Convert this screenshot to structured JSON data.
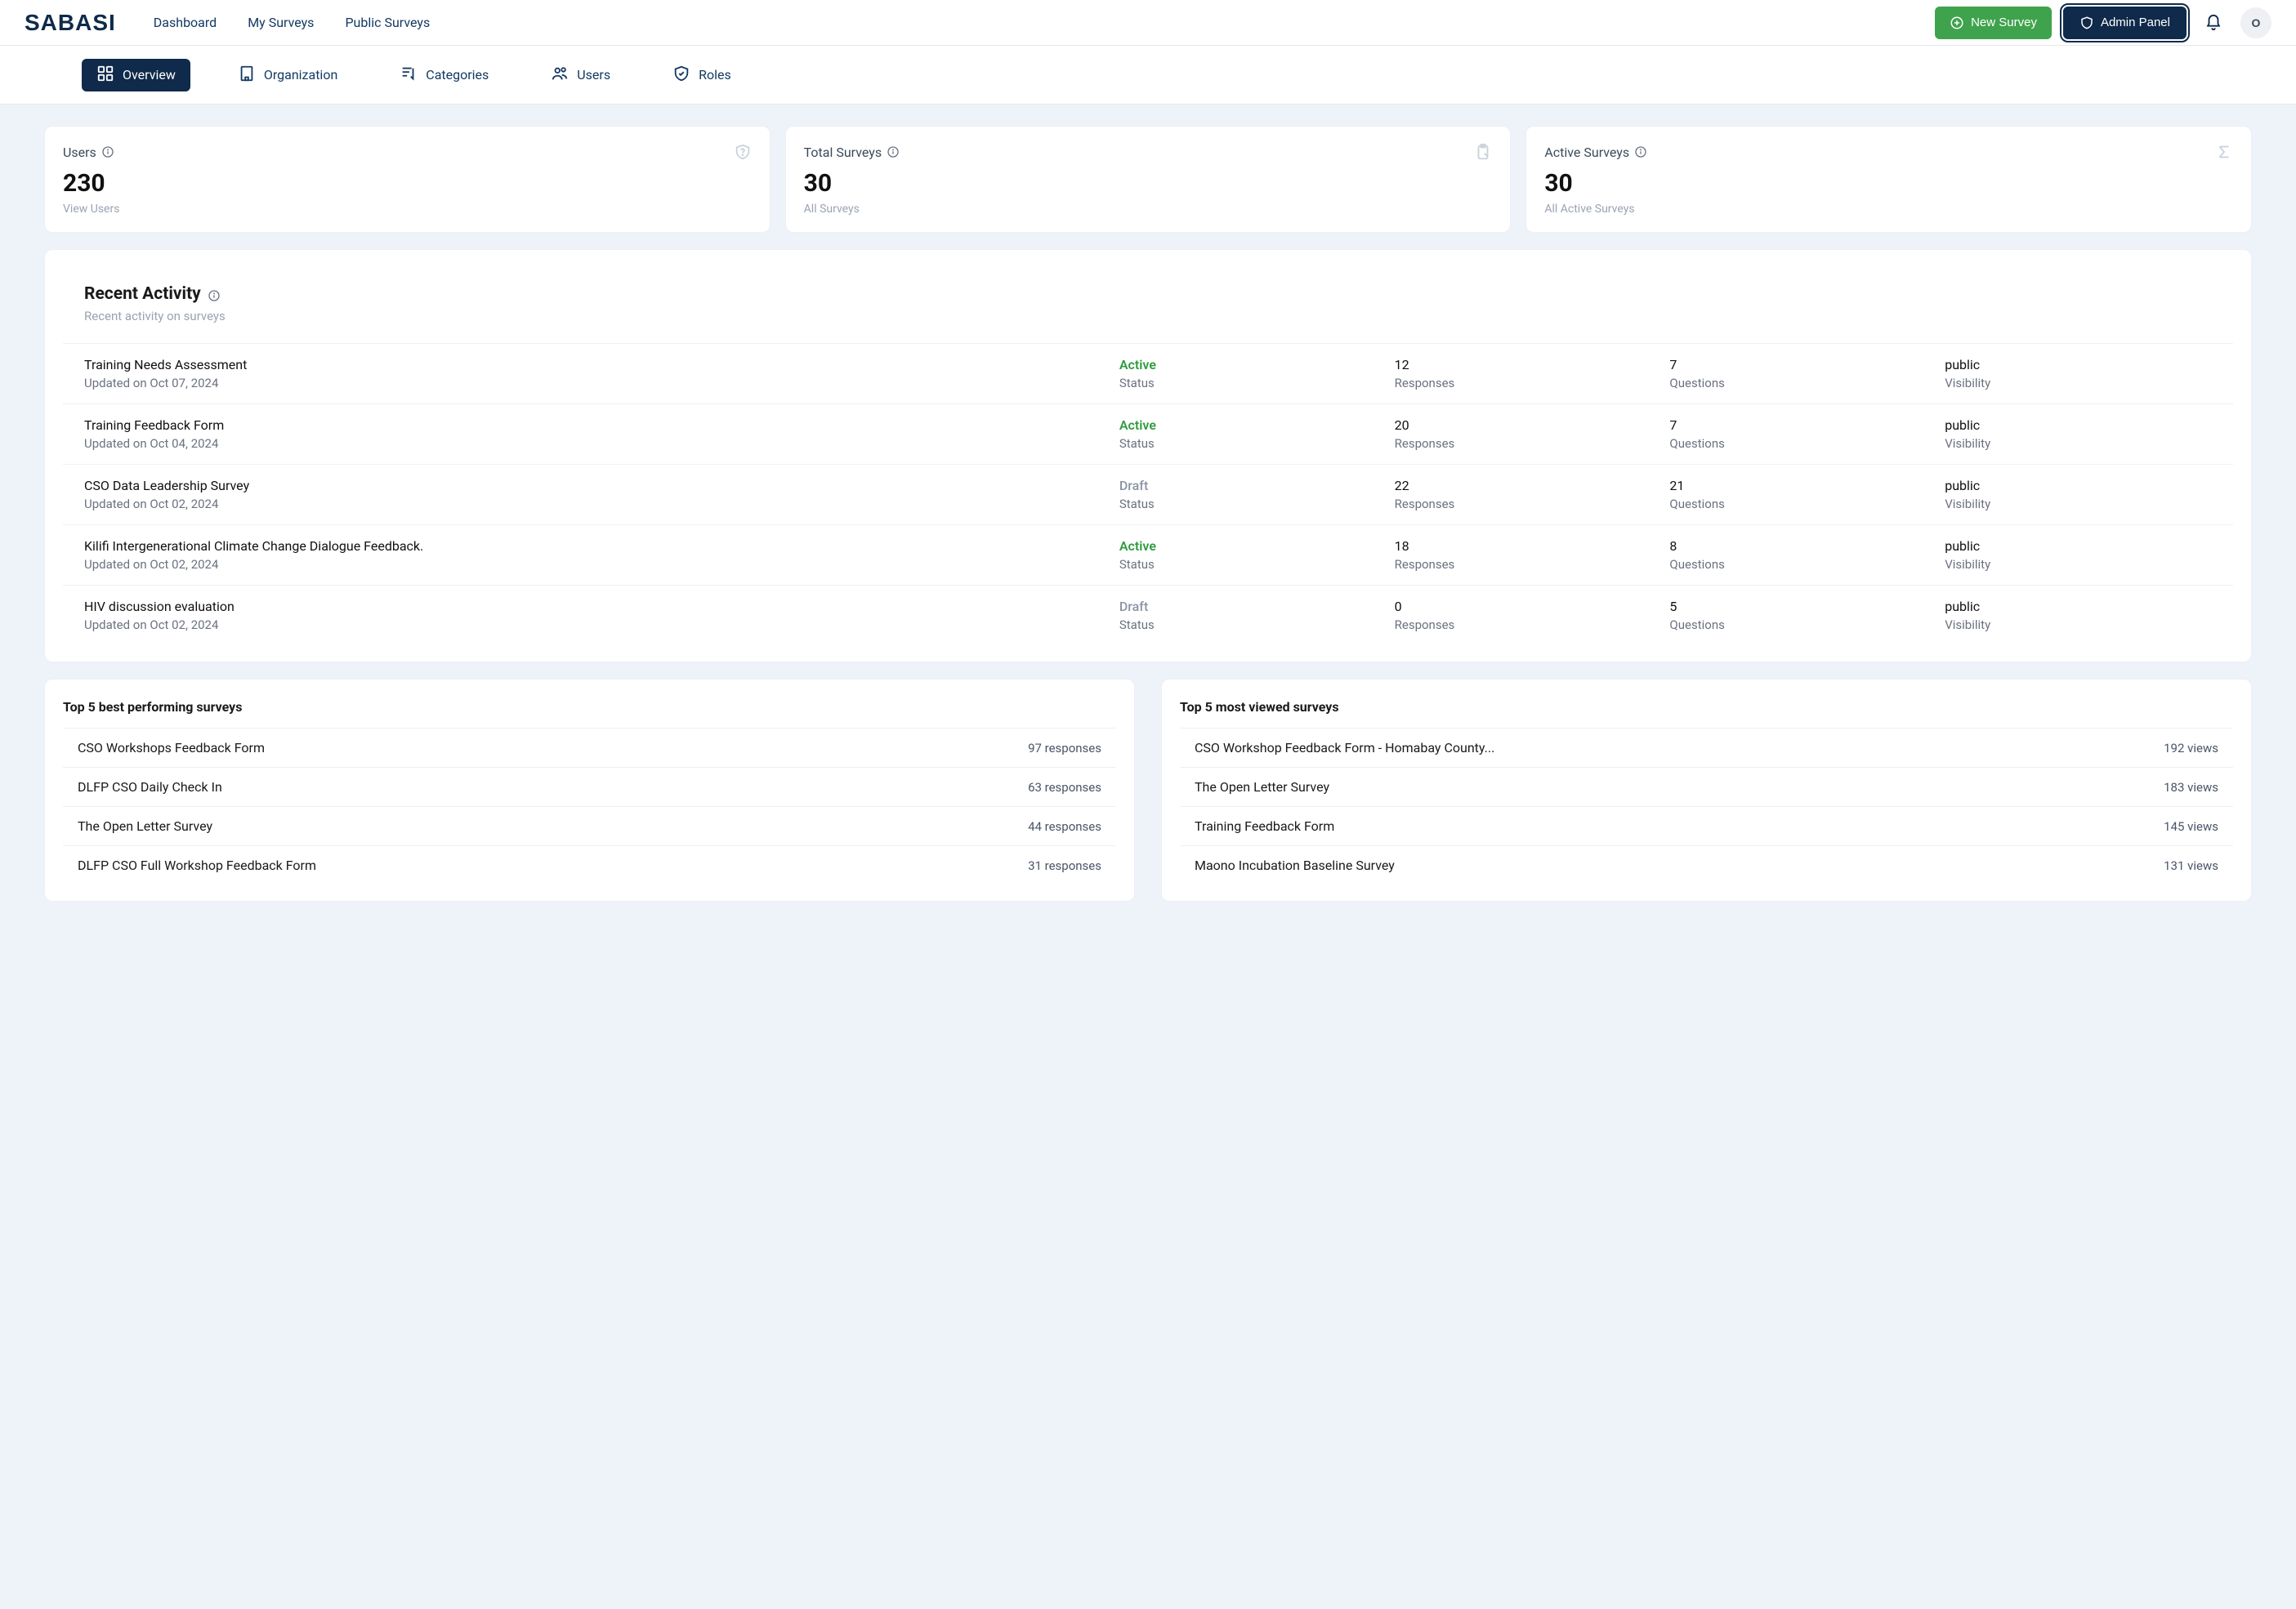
{
  "brand": "SABASI",
  "nav": {
    "dashboard": "Dashboard",
    "my_surveys": "My Surveys",
    "public_surveys": "Public Surveys"
  },
  "buttons": {
    "new_survey": "New Survey",
    "admin_panel": "Admin Panel"
  },
  "avatar_initial": "O",
  "tabs": {
    "overview": "Overview",
    "organization": "Organization",
    "categories": "Categories",
    "users": "Users",
    "roles": "Roles"
  },
  "stats": {
    "users": {
      "label": "Users",
      "value": "230",
      "link": "View Users"
    },
    "total": {
      "label": "Total Surveys",
      "value": "30",
      "link": "All Surveys"
    },
    "active": {
      "label": "Active Surveys",
      "value": "30",
      "link": "All Active Surveys"
    }
  },
  "activity": {
    "title": "Recent Activity",
    "subtitle": "Recent activity on surveys",
    "labels": {
      "status": "Status",
      "responses": "Responses",
      "questions": "Questions",
      "visibility": "Visibility"
    },
    "rows": [
      {
        "name": "Training Needs Assessment",
        "updated": "Updated on Oct 07, 2024",
        "status": "Active",
        "status_class": "green",
        "responses": "12",
        "questions": "7",
        "visibility": "public"
      },
      {
        "name": "Training Feedback Form",
        "updated": "Updated on Oct 04, 2024",
        "status": "Active",
        "status_class": "green",
        "responses": "20",
        "questions": "7",
        "visibility": "public"
      },
      {
        "name": "CSO Data Leadership Survey",
        "updated": "Updated on Oct 02, 2024",
        "status": "Draft",
        "status_class": "gray",
        "responses": "22",
        "questions": "21",
        "visibility": "public"
      },
      {
        "name": "Kilifi Intergenerational Climate Change Dialogue Feedback.",
        "updated": "Updated on Oct 02, 2024",
        "status": "Active",
        "status_class": "green",
        "responses": "18",
        "questions": "8",
        "visibility": "public"
      },
      {
        "name": "HIV discussion evaluation",
        "updated": "Updated on Oct 02, 2024",
        "status": "Draft",
        "status_class": "gray",
        "responses": "0",
        "questions": "5",
        "visibility": "public"
      }
    ]
  },
  "best": {
    "title": "Top 5 best performing surveys",
    "items": [
      {
        "name": "CSO Workshops Feedback Form",
        "metric": "97 responses"
      },
      {
        "name": "DLFP CSO Daily Check In",
        "metric": "63 responses"
      },
      {
        "name": "The Open Letter Survey",
        "metric": "44 responses"
      },
      {
        "name": "DLFP CSO Full Workshop Feedback Form",
        "metric": "31 responses"
      }
    ]
  },
  "most_viewed": {
    "title": "Top 5 most viewed surveys",
    "items": [
      {
        "name": "CSO Workshop Feedback Form - Homabay County...",
        "metric": "192 views"
      },
      {
        "name": "The Open Letter Survey",
        "metric": "183 views"
      },
      {
        "name": "Training Feedback Form",
        "metric": "145 views"
      },
      {
        "name": "Maono Incubation Baseline Survey",
        "metric": "131 views"
      }
    ]
  }
}
